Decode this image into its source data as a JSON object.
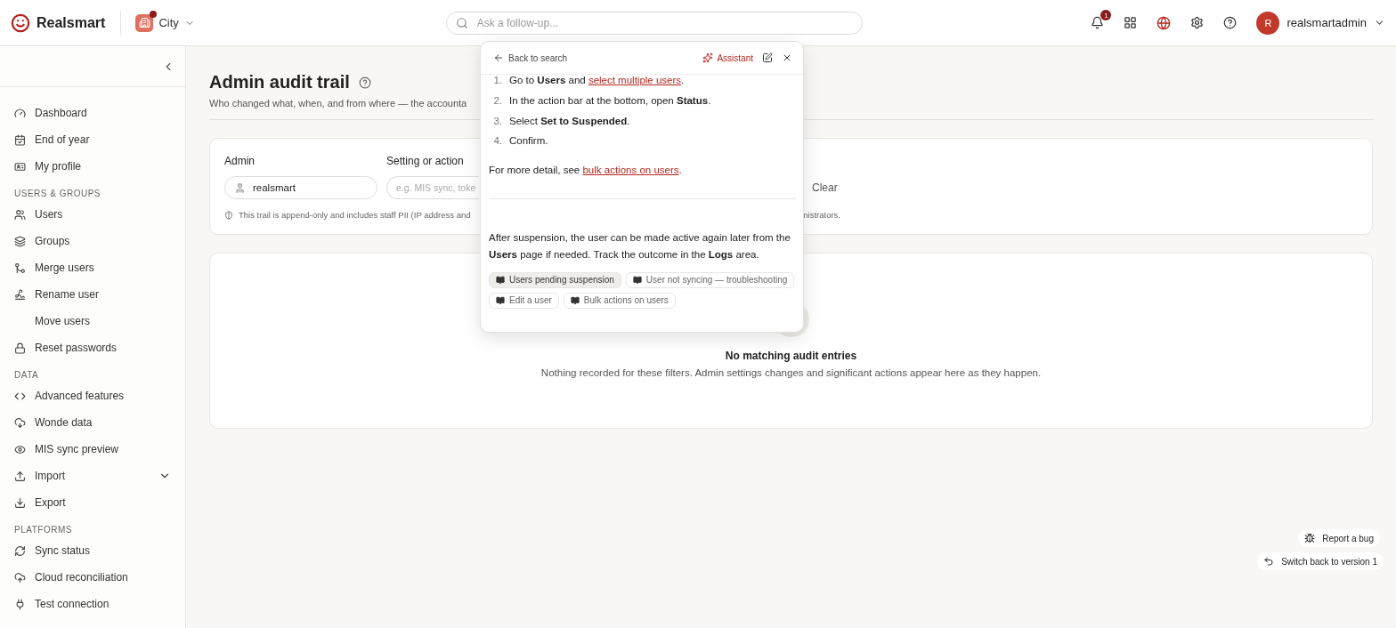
{
  "header": {
    "brand": "Realsmart",
    "org": {
      "name": "City",
      "has_alert": true
    },
    "search": {
      "placeholder": "Ask a follow-up..."
    },
    "notifications": {
      "badge": "1"
    },
    "user": {
      "initial": "R",
      "name": "realsmartadmin"
    }
  },
  "sidebar": {
    "sections": [
      {
        "items": [
          {
            "label": "Dashboard"
          },
          {
            "label": "End of year"
          },
          {
            "label": "My profile"
          }
        ]
      },
      {
        "title": "USERS & GROUPS",
        "items": [
          {
            "label": "Users"
          },
          {
            "label": "Groups"
          },
          {
            "label": "Merge users"
          },
          {
            "label": "Rename user"
          },
          {
            "label": "Move users"
          },
          {
            "label": "Reset passwords"
          }
        ]
      },
      {
        "title": "DATA",
        "items": [
          {
            "label": "Advanced features"
          },
          {
            "label": "Wonde data"
          },
          {
            "label": "MIS sync preview"
          },
          {
            "label": "Import",
            "expanded": false
          },
          {
            "label": "Export"
          }
        ]
      },
      {
        "title": "PLATFORMS",
        "items": [
          {
            "label": "Sync status"
          },
          {
            "label": "Cloud reconciliation"
          },
          {
            "label": "Test connection"
          }
        ]
      }
    ]
  },
  "page": {
    "title": "Admin audit trail",
    "subtitle": "Who changed what, when, and from where — the accounta",
    "filters": {
      "admin": {
        "label": "Admin",
        "value": "realsmart"
      },
      "setting": {
        "label": "Setting or action",
        "placeholder": "e.g. MIS sync, toke"
      },
      "clear": "Clear"
    },
    "note": {
      "start": "This trail is append-only and includes staff PII (IP address and",
      "end": "nistrators."
    },
    "empty": {
      "title": "No matching audit entries",
      "text": "Nothing recorded for these filters. Admin settings changes and significant actions appear here as they happen."
    }
  },
  "assistant": {
    "back": "Back to search",
    "title": "Assistant",
    "steps": [
      {
        "number": "1.",
        "segments": [
          {
            "kind": "text",
            "text": "Go to **Users** and "
          },
          {
            "kind": "link",
            "text": "select multiple users"
          },
          {
            "kind": "text",
            "text": "."
          }
        ]
      },
      {
        "number": "2.",
        "segments": [
          {
            "kind": "text",
            "text": "In the action bar at the bottom, open **Status**."
          }
        ]
      },
      {
        "number": "3.",
        "segments": [
          {
            "kind": "text",
            "text": "Select **Set to Suspended**."
          }
        ]
      },
      {
        "number": "4.",
        "segments": [
          {
            "kind": "text",
            "text": "Confirm."
          }
        ]
      }
    ],
    "detail": [
      {
        "kind": "text",
        "text": "For more detail, see "
      },
      {
        "kind": "link",
        "text": "bulk actions on users"
      },
      {
        "kind": "text",
        "text": "."
      }
    ],
    "after": "After suspension, the user can be made active again later from the **Users** page if needed. Track the outcome in the **Logs** area.",
    "chips": [
      {
        "label": "Users pending suspension",
        "selected": true
      },
      {
        "label": "User not syncing — troubleshooting",
        "selected": false
      },
      {
        "label": "Edit a user",
        "selected": false
      },
      {
        "label": "Bulk actions on users",
        "selected": false
      }
    ]
  },
  "floating": {
    "report": "Report a bug",
    "switch": "Switch back to version 1"
  }
}
